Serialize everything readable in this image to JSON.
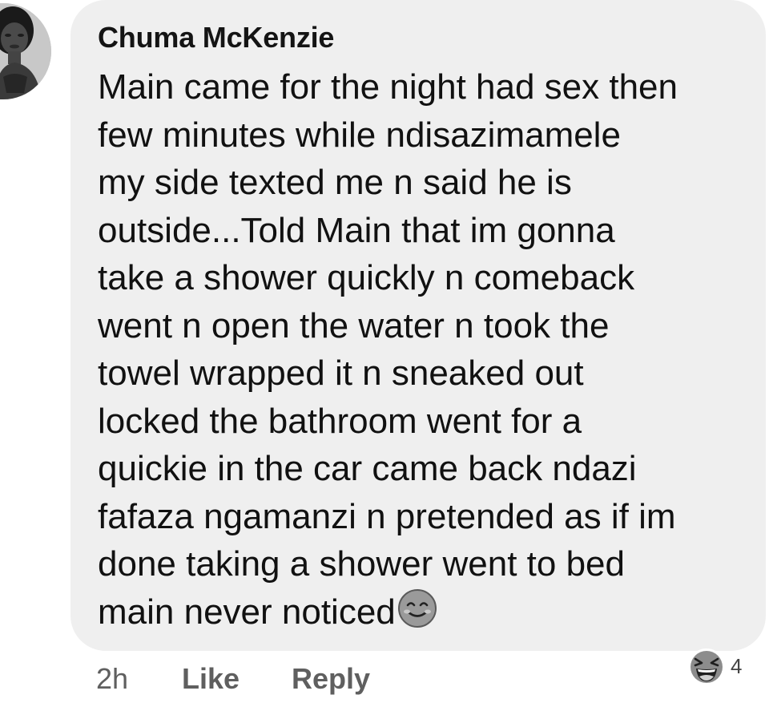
{
  "comment": {
    "author": "Chuma McKenzie",
    "lines": [
      "Main came for the night had sex then",
      "few minutes while ndisazimamele",
      "my side texted me n said he is",
      "outside...Told Main that im gonna",
      "take a shower quickly n comeback",
      "went n open the water n took the",
      "towel wrapped it n sneaked out",
      "locked the bathroom went for a",
      "quickie in the car came back ndazi",
      "fafaza ngamanzi n pretended as if im",
      "done taking a shower went to bed",
      "main never noticed"
    ],
    "trailing_emoji": "smiling-face-icon",
    "time": "2h",
    "like_label": "Like",
    "reply_label": "Reply",
    "reaction": {
      "icon": "laughing-face-icon",
      "count": "4"
    }
  },
  "colors": {
    "bubble": "#efefef",
    "text": "#111111",
    "action_text": "#5f5f5f"
  }
}
